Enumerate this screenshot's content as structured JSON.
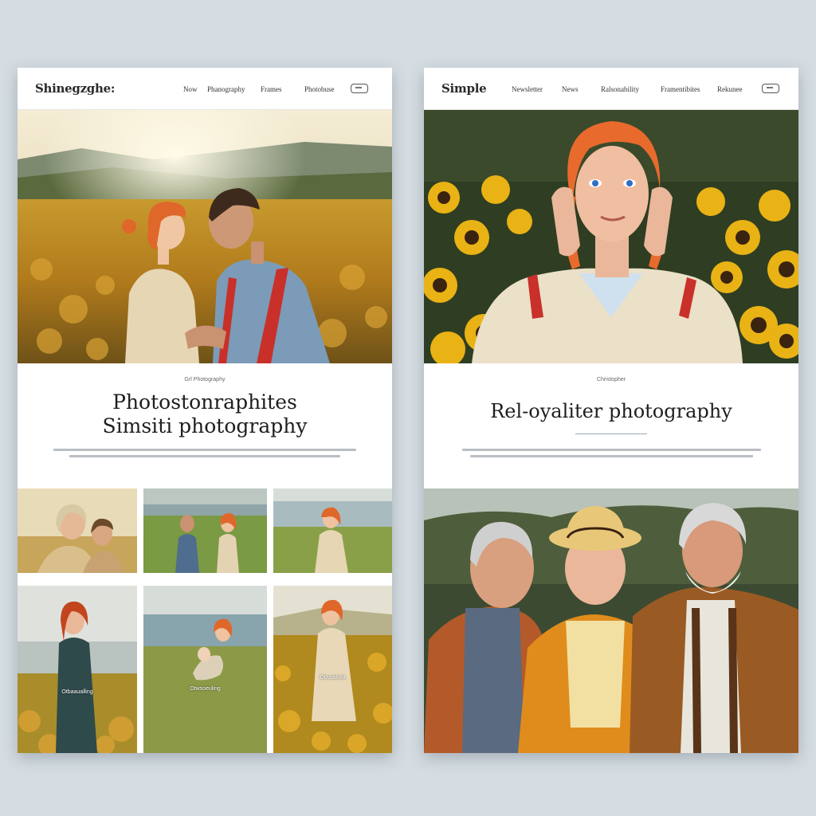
{
  "left": {
    "brand": "Shinegzghe:",
    "nav": [
      "Now",
      "Phanography",
      "Frames",
      "Photobuse"
    ],
    "kicker": "Grl Photography",
    "headline": [
      "Photostonraphites",
      "Simsiti photography"
    ],
    "captions": [
      "Otbaaualling",
      "Otwsoeuling",
      "Otwualwia"
    ]
  },
  "right": {
    "brand": "Simple",
    "nav": [
      "Newsletter",
      "News",
      "Ralsonability",
      "Framentibites",
      "Rekunee"
    ],
    "kicker": "Christopher",
    "headline": "Rel-oyaliter photography"
  },
  "colors": {
    "background": "#d5dde2",
    "card": "#ffffff",
    "accent_rule": "#9aa7b3"
  },
  "icons": [
    "menu-button-icon"
  ]
}
